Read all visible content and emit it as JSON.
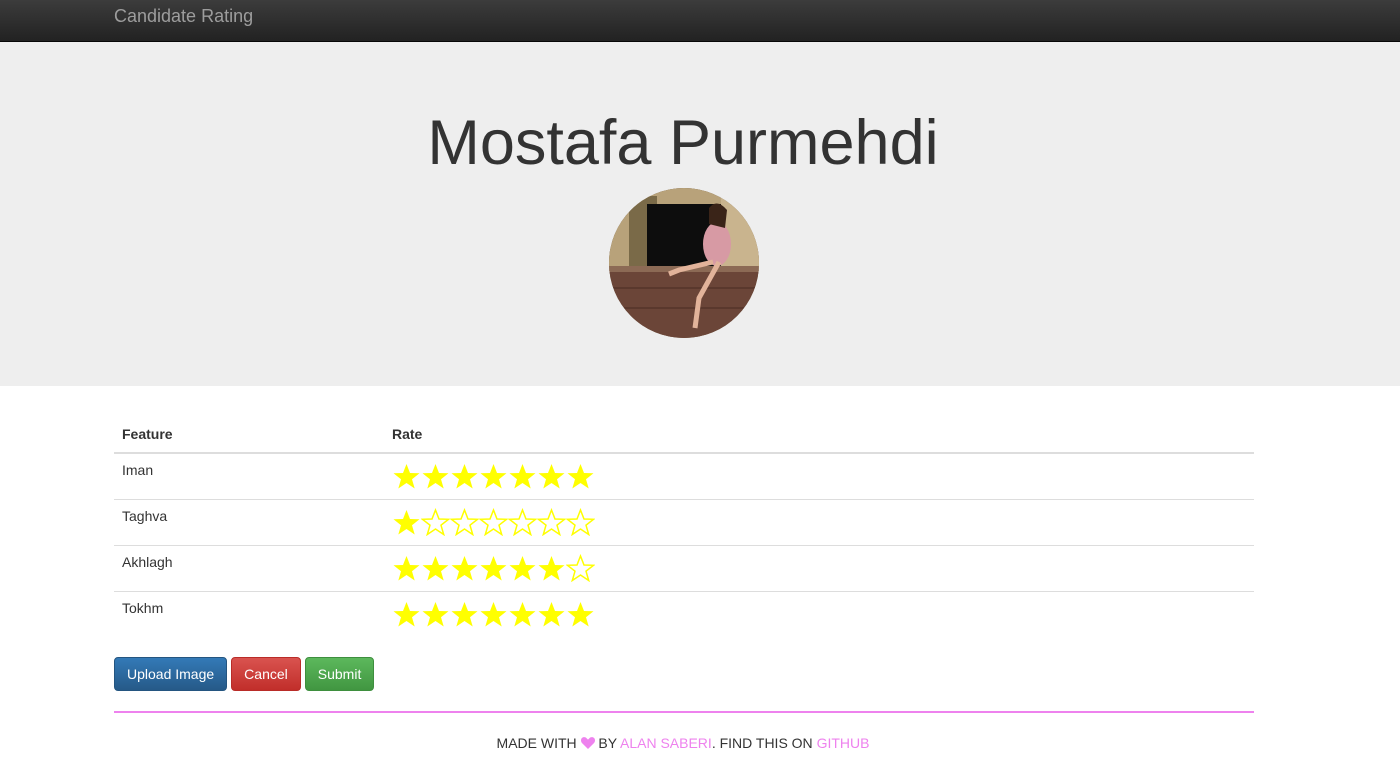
{
  "navbar": {
    "brand": "Candidate Rating"
  },
  "candidate": {
    "name": "Mostafa Purmehdi",
    "avatar_icon": "candidate-photo"
  },
  "table": {
    "headers": [
      "Feature",
      "Rate"
    ],
    "max_stars": 7,
    "star_color": "#ffff00",
    "rows": [
      {
        "feature": "Iman",
        "rating": 7
      },
      {
        "feature": "Taghva",
        "rating": 1
      },
      {
        "feature": "Akhlagh",
        "rating": 6
      },
      {
        "feature": "Tokhm",
        "rating": 7
      }
    ]
  },
  "buttons": {
    "upload": "Upload Image",
    "cancel": "Cancel",
    "submit": "Submit"
  },
  "footer": {
    "made_with": "MADE WITH",
    "by": "BY",
    "author": "ALAN SABERI",
    "find": ". FIND THIS ON",
    "github": "GITHUB",
    "accent_color": "#ee82ee"
  }
}
